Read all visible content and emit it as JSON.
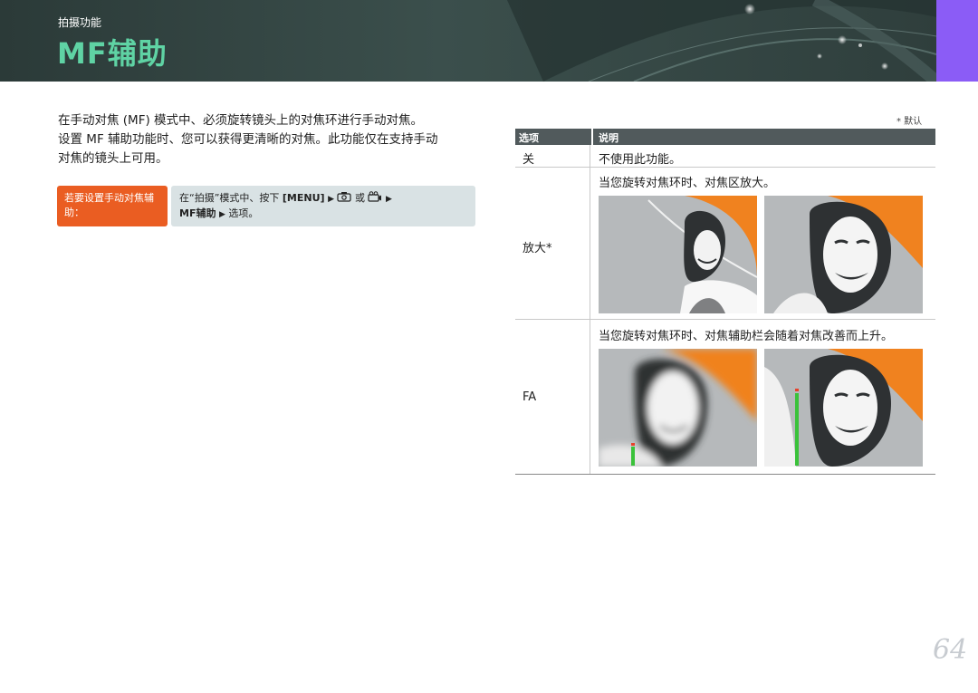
{
  "header": {
    "section": "拍摄功能",
    "title": "MF辅助",
    "colors": {
      "banner": "#2e3d3b",
      "title": "#5fd3a4",
      "tab": "#8b5cf6"
    }
  },
  "intro": {
    "lines": [
      "在手动对焦 (MF) 模式中、必须旋转镜头上的对焦环进行手动对焦。",
      "设置 MF 辅助功能时、您可以获得更清晰的对焦。此功能仅在支持手动",
      "对焦的镜头上可用。"
    ]
  },
  "howto": {
    "label": "若要设置手动对焦辅助：",
    "line1_prefix": "在“拍摄”模式中、按下",
    "menu_key": "[MENU]",
    "or": "或",
    "option_name": "MF辅助",
    "line2_suffix": "选项。",
    "colors": {
      "label_bg": "#ea5d22",
      "body_bg": "#d9e2e4"
    }
  },
  "table": {
    "default_note": "* 默认",
    "col_option": "选项",
    "col_description": "说明",
    "rows": [
      {
        "option": "关",
        "description": "不使用此功能。"
      },
      {
        "option": "放大*",
        "description": "当您旋转对焦环时、对焦区放大。"
      },
      {
        "option": "FA",
        "description": "当您旋转对焦环时、对焦辅助栏会随着对焦改善而上升。"
      }
    ]
  },
  "focus_bars": {
    "before_level": 0.2,
    "after_level": 0.67
  },
  "page_number": "64"
}
